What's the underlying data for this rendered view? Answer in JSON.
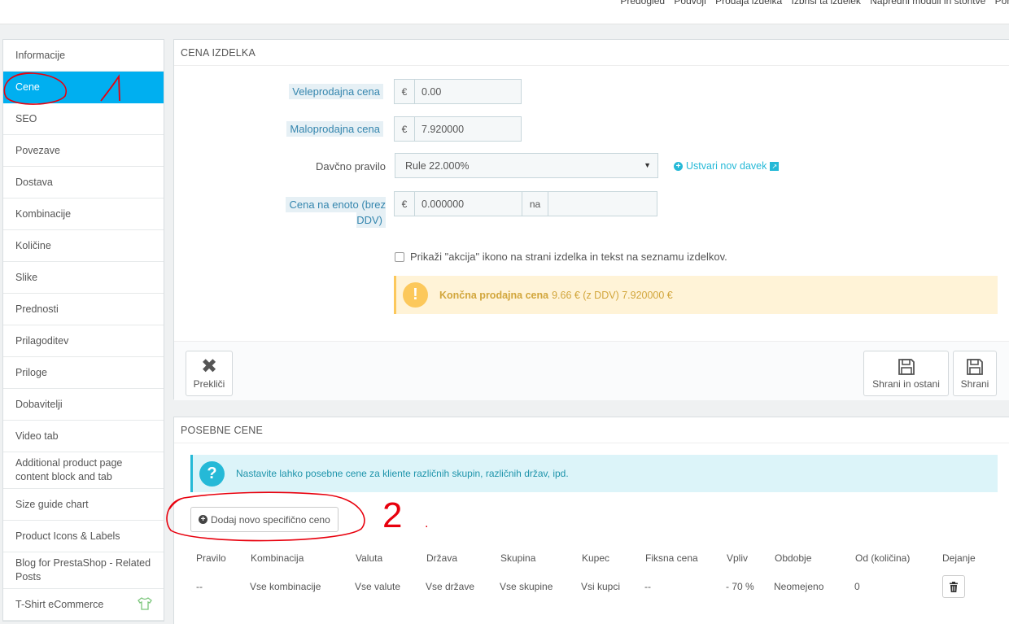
{
  "topbar": {
    "crumbs": [
      "Predogled",
      "Podvoji",
      "Prodaja izdelka",
      "Izbriši ta izdelek",
      "Napredni moduli in storitve",
      "Pomoč"
    ]
  },
  "sidebar": {
    "items": [
      {
        "label": "Informacije"
      },
      {
        "label": "Cene"
      },
      {
        "label": "SEO"
      },
      {
        "label": "Povezave"
      },
      {
        "label": "Dostava"
      },
      {
        "label": "Kombinacije"
      },
      {
        "label": "Količine"
      },
      {
        "label": "Slike"
      },
      {
        "label": "Prednosti"
      },
      {
        "label": "Prilagoditev"
      },
      {
        "label": "Priloge"
      },
      {
        "label": "Dobavitelji"
      },
      {
        "label": "Video tab"
      },
      {
        "label": "Additional product page content block and tab"
      },
      {
        "label": "Size guide chart"
      },
      {
        "label": "Product Icons & Labels"
      },
      {
        "label": "Blog for PrestaShop - Related Posts"
      },
      {
        "label": "T-Shirt eCommerce"
      }
    ]
  },
  "price_panel": {
    "heading": "CENA IZDELKA",
    "wholesale": {
      "label": "Veleprodajna cena",
      "currency": "€",
      "value": "0.00"
    },
    "retail": {
      "label": "Maloprodajna cena",
      "currency": "€",
      "value": "7.920000"
    },
    "tax": {
      "label": "Davčno pravilo",
      "selected": "Rule 22.000%",
      "create_link": "Ustvari nov davek"
    },
    "unit": {
      "label": "Cena na enoto (brez DDV)",
      "currency": "€",
      "value": "0.000000",
      "per": "na",
      "unit_value": ""
    },
    "on_sale_checkbox": "Prikaži \"akcija\" ikono na strani izdelka in tekst na seznamu izdelkov.",
    "final_price": {
      "title": "Končna prodajna cena",
      "text": "9.66 € (z DDV) 7.920000 €"
    },
    "buttons": {
      "cancel": "Prekliči",
      "save_stay": "Shrani in ostani",
      "save": "Shrani"
    }
  },
  "special_panel": {
    "heading": "POSEBNE CENE",
    "info": "Nastavite lahko posebne cene za kliente različnih skupin, različnih držav, ipd.",
    "add_button": "Dodaj novo specifično ceno",
    "columns": [
      "Pravilo",
      "Kombinacija",
      "Valuta",
      "Država",
      "Skupina",
      "Kupec",
      "Fiksna cena",
      "Vpliv",
      "Obdobje",
      "Od (količina)",
      "Dejanje"
    ],
    "rows": [
      [
        "--",
        "Vse kombinacije",
        "Vse valute",
        "Vse države",
        "Vse skupine",
        "Vsi kupci",
        "--",
        "- 70 %",
        "Neomejeno",
        "0"
      ]
    ]
  },
  "annotations": {
    "one": "1",
    "two": "2",
    "dot": "."
  },
  "colors": {
    "active": "#00aff0",
    "link": "#25b9d7",
    "warning": "#fcc85b",
    "annotation": "#e8000d"
  }
}
